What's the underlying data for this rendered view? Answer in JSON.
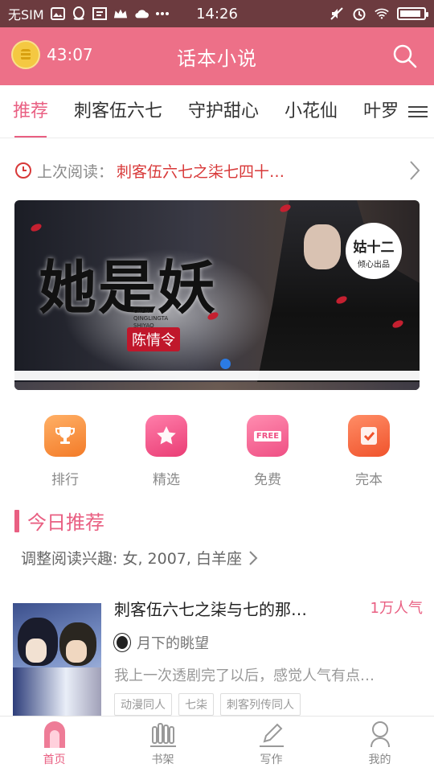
{
  "status_bar": {
    "carrier": "无SIM",
    "time": "14:26",
    "battery_level": 0.9
  },
  "header": {
    "timer": "43:07",
    "title": "话本小说"
  },
  "tabs": [
    {
      "label": "推荐",
      "active": true
    },
    {
      "label": "刺客伍六七",
      "active": false
    },
    {
      "label": "守护甜心",
      "active": false
    },
    {
      "label": "小花仙",
      "active": false
    },
    {
      "label": "叶罗",
      "active": false
    }
  ],
  "last_read": {
    "label": "上次阅读：",
    "book": "刺客伍六七之柒七四十…"
  },
  "banner": {
    "title": "她是妖",
    "pinyin_line1": "CHEN",
    "pinyin_line2": "QINGLINGTA",
    "pinyin_line3": "SHIYAO",
    "seal": "陈情令",
    "badge_main": "姑十二",
    "badge_sub": "倾心出品",
    "page_index": 1
  },
  "categories": [
    {
      "label": "排行",
      "icon": "trophy-icon"
    },
    {
      "label": "精选",
      "icon": "star-icon"
    },
    {
      "label": "免费",
      "icon": "free-tag-icon",
      "tag": "FREE"
    },
    {
      "label": "完本",
      "icon": "check-note-icon"
    }
  ],
  "recommend": {
    "section_title": "今日推荐",
    "interest_text": "调整阅读兴趣: 女, 2007, 白羊座"
  },
  "book": {
    "title": "刺客伍六七之柒与七的那…",
    "popularity": "1万人气",
    "author": "月下的眺望",
    "description": "我上一次透剧完了以后，感觉人气有点…",
    "tags": [
      "动漫同人",
      "七柒",
      "刺客列传同人"
    ]
  },
  "bottom_nav": [
    {
      "label": "首页",
      "icon": "home-icon",
      "active": true
    },
    {
      "label": "书架",
      "icon": "bookshelf-icon",
      "active": false
    },
    {
      "label": "写作",
      "icon": "pen-icon",
      "active": false
    },
    {
      "label": "我的",
      "icon": "profile-icon",
      "active": false
    }
  ],
  "colors": {
    "brand_pink": "#ed7088",
    "accent_pink": "#e95f82",
    "status_bar": "#6c3b3f",
    "last_read_red": "#d83838"
  }
}
